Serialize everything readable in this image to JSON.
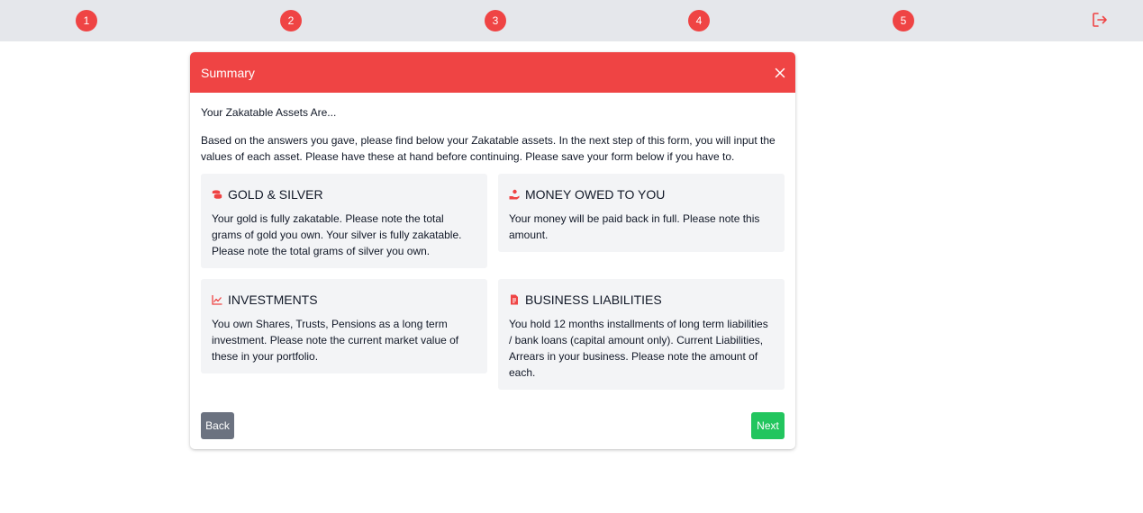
{
  "steps": [
    "1",
    "2",
    "3",
    "4",
    "5"
  ],
  "colors": {
    "accent": "#ef4444",
    "topbar": "#e5e7eb",
    "card": "#f3f4f6",
    "back": "#6b7280",
    "next": "#22c55e"
  },
  "icons": {
    "logout": "logout-icon",
    "close": "close-icon"
  },
  "modal": {
    "title": "Summary",
    "subtitle": "Your Zakatable Assets Are...",
    "intro": "Based on the answers you gave, please find below your Zakatable assets. In the next step of this form, you will input the values of each asset. Please have these at hand before continuing. Please save your form below if you have to.",
    "cards": [
      {
        "icon": "coins-icon",
        "title": "GOLD & SILVER",
        "text": "Your gold is fully zakatable. Please note the total grams of gold you own. Your silver is fully zakatable. Please note the total grams of silver you own."
      },
      {
        "icon": "hand-holding-money-icon",
        "title": "MONEY OWED TO YOU",
        "text": "Your money will be paid back in full. Please note this amount."
      },
      {
        "icon": "chart-line-icon",
        "title": "INVESTMENTS",
        "text": "You own Shares, Trusts, Pensions as a long term investment. Please note the current market value of these in your portfolio."
      },
      {
        "icon": "invoice-icon",
        "title": "BUSINESS LIABILITIES",
        "text": "You hold 12 months installments of long term liabilities / bank loans (capital amount only). Current Liabilities, Arrears in your business. Please note the amount of each."
      }
    ],
    "back_label": "Back",
    "next_label": "Next"
  }
}
